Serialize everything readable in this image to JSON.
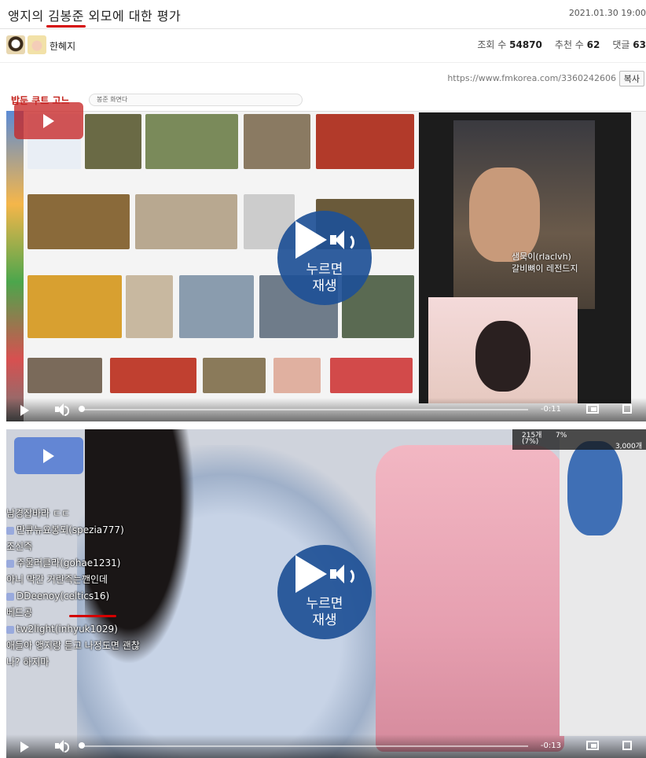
{
  "post": {
    "title_part1": "앵지의 ",
    "title_highlight": "김봉준",
    "title_part2": " 외모에 대한 평가",
    "date": "2021.01.30 19:00",
    "author": "한혜지",
    "views_label": "조회 수",
    "views": "54870",
    "likes_label": "추천 수",
    "likes": "62",
    "comments_label": "댓글",
    "comments": "63",
    "url": "https://www.fmkorea.com/3360242606",
    "copy_label": "복사"
  },
  "video1": {
    "play_label": "누르면\n재생",
    "time": "-0:11",
    "progress": 0.0,
    "browser_logo": "밥둔 쿠트 고느",
    "search_text": "봉준 화면다",
    "chat_name": "샘묵이(rlaclvh)",
    "chat_msg": "갈비뼈이 레전드지"
  },
  "video2": {
    "play_label": "누르면\n재생",
    "time": "-0:13",
    "progress": 0.0,
    "counter_top": "215개",
    "counter_pct": "(7%)",
    "counter_right": "3,000개",
    "pct_badge": "7%",
    "chat": [
      {
        "text": "남경잡바라 ㄷㄷ"
      },
      {
        "text": "만큐뉴요봉되(spezia777)"
      },
      {
        "text": "조신즉"
      },
      {
        "text": "주물러클라(gohae1231)"
      },
      {
        "text": "아니 막간 거란즉는깬인데"
      },
      {
        "text": "DDeenoy(celtics16)"
      },
      {
        "text": "베드공"
      },
      {
        "text": "tw2light(inhyuk1029)"
      },
      {
        "text": "애들아 앵지랑 듣고 나정도면 괜찮"
      },
      {
        "text": "나? 하지마"
      }
    ]
  },
  "colors": {
    "accent_red": "#d40000",
    "play_blue": "#1e5096"
  }
}
